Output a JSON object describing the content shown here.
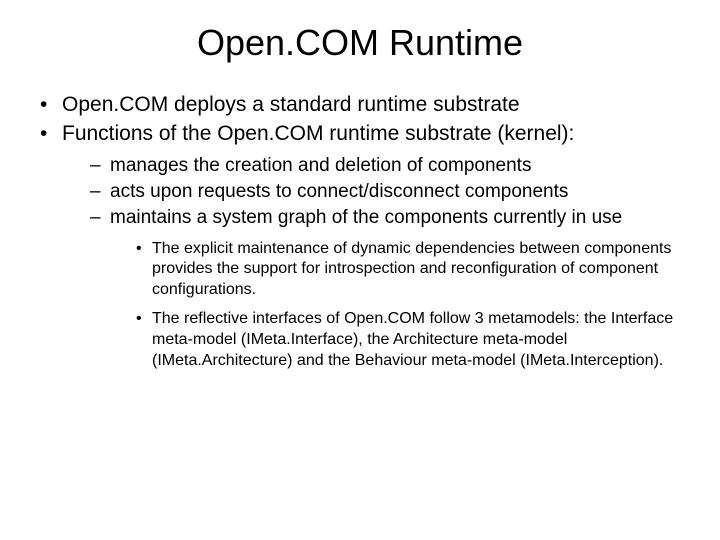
{
  "title": "Open.COM Runtime",
  "bullets": [
    {
      "text": "Open.COM deploys a standard runtime substrate"
    },
    {
      "text": "Functions of the Open.COM runtime substrate (kernel):",
      "sub": [
        {
          "text": "manages the creation and deletion of components"
        },
        {
          "text": "acts upon requests to connect/disconnect components"
        },
        {
          "text": "maintains a system graph of the components currently in use",
          "sub": [
            {
              "text": "The explicit maintenance of dynamic dependencies between components provides the support for introspection and reconfiguration of component configurations."
            },
            {
              "text": "The reflective interfaces of Open.COM follow  3 metamodels:   the Interface meta-model (IMeta.Interface), the Architecture meta-model (IMeta.Architecture) and the Behaviour meta-model (IMeta.Interception)."
            }
          ]
        }
      ]
    }
  ]
}
